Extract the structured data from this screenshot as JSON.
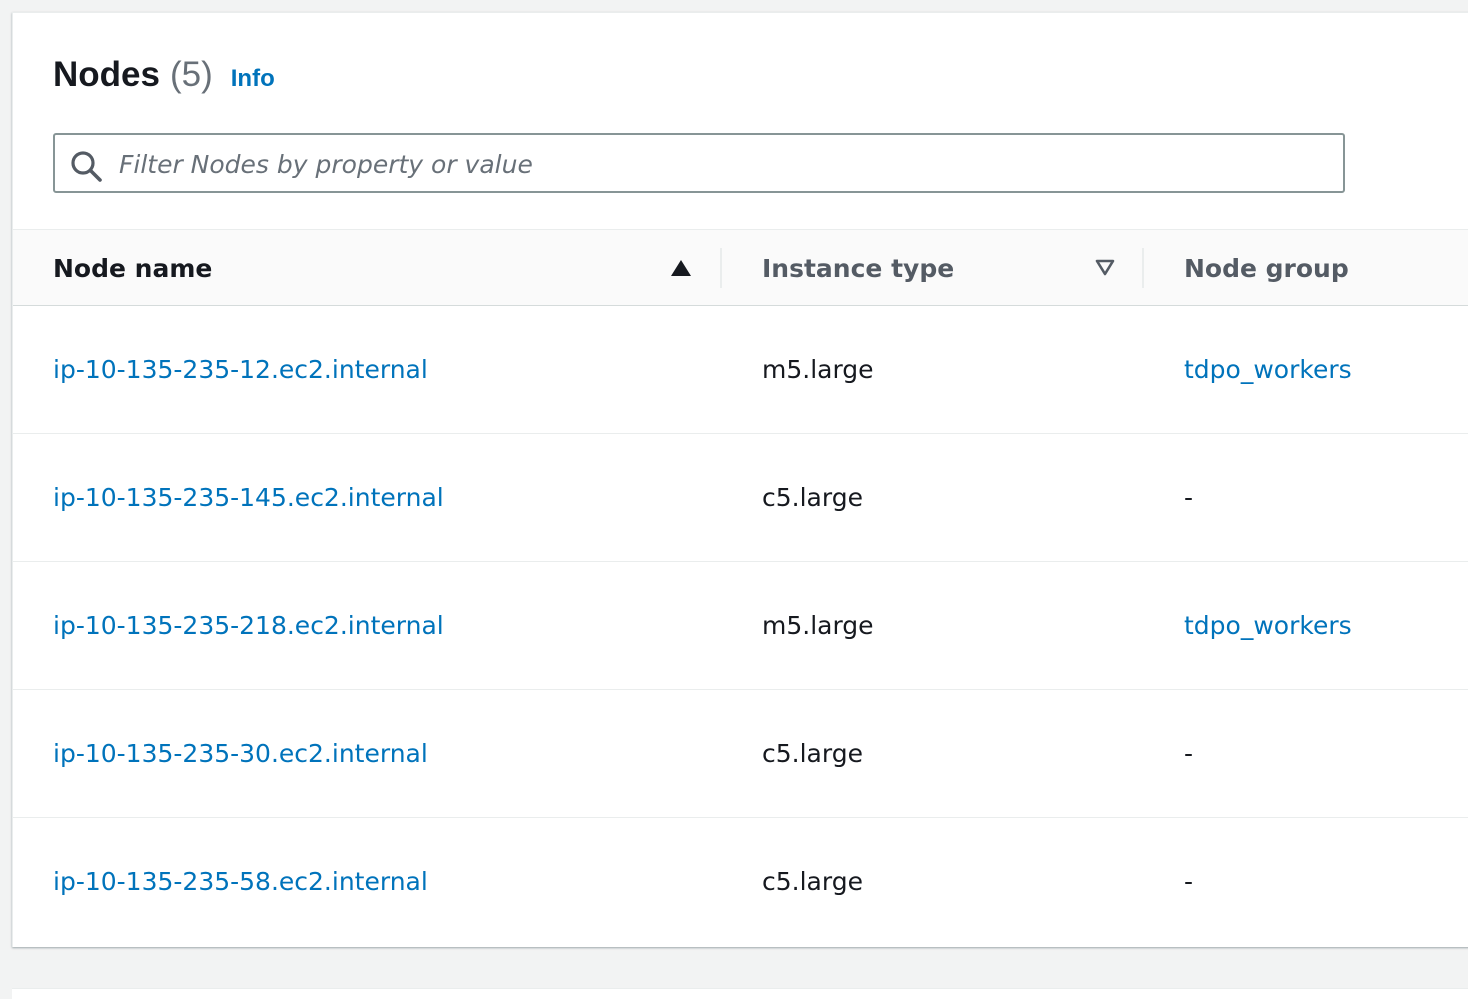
{
  "header": {
    "title": "Nodes",
    "count": "(5)",
    "info_label": "Info"
  },
  "search": {
    "placeholder": "Filter Nodes by property or value",
    "value": ""
  },
  "table": {
    "columns": {
      "node_name": "Node name",
      "instance_type": "Instance type",
      "node_group": "Node group"
    },
    "sort": {
      "column": "node_name",
      "direction": "ascending"
    },
    "rows": [
      {
        "node_name": "ip-10-135-235-12.ec2.internal",
        "instance_type": "m5.large",
        "node_group": "tdpo_workers"
      },
      {
        "node_name": "ip-10-135-235-145.ec2.internal",
        "instance_type": "c5.large",
        "node_group": "-"
      },
      {
        "node_name": "ip-10-135-235-218.ec2.internal",
        "instance_type": "m5.large",
        "node_group": "tdpo_workers"
      },
      {
        "node_name": "ip-10-135-235-30.ec2.internal",
        "instance_type": "c5.large",
        "node_group": "-"
      },
      {
        "node_name": "ip-10-135-235-58.ec2.internal",
        "instance_type": "c5.large",
        "node_group": "-"
      }
    ]
  },
  "icons": {
    "search": "search-icon",
    "sort_active": "caret-up-filled-icon",
    "sort_inactive": "caret-down-outline-icon"
  },
  "colors": {
    "link": "#0073bb",
    "text": "#16191f",
    "muted": "#687078",
    "header_text": "#545b64",
    "border": "#879596",
    "background": "#f2f3f3"
  }
}
